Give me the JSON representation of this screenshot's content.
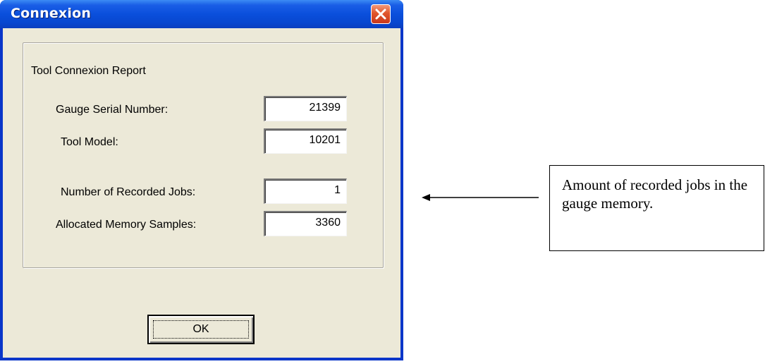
{
  "window": {
    "title": "Connexion",
    "close_icon": "close-x-icon"
  },
  "group": {
    "legend": "Tool Connexion Report"
  },
  "fields": {
    "gauge_serial": {
      "label": "Gauge Serial Number:",
      "value": "21399"
    },
    "tool_model": {
      "label": "Tool Model:",
      "value": "10201"
    },
    "recorded_jobs": {
      "label": "Number of Recorded Jobs:",
      "value": "1"
    },
    "memory_samples": {
      "label": "Allocated Memory Samples:",
      "value": "3360"
    }
  },
  "buttons": {
    "ok_label": "OK"
  },
  "annotation": {
    "text": "Amount of recorded jobs in the gauge memory.",
    "arrow_icon": "left-arrow-icon"
  },
  "colors": {
    "titlebar": "#0a4fdc",
    "window_face": "#ece9d8",
    "close_button": "#e0562c"
  }
}
